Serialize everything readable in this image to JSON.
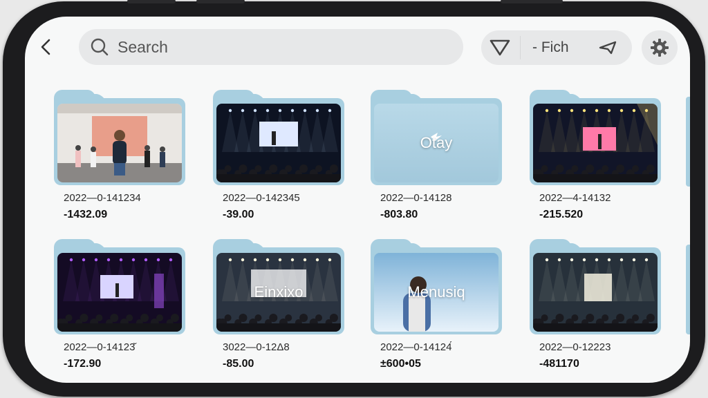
{
  "toolbar": {
    "search_placeholder": "Search",
    "filter_label": "- Fiсh"
  },
  "folders": [
    {
      "date": "2022—0-141234",
      "value": "-1432.09",
      "overlay": "",
      "scene": "stage-person",
      "accent": "#e7907a"
    },
    {
      "date": "2022—0-142345",
      "value": "-39.00",
      "overlay": "",
      "scene": "concert-white",
      "accent": "#dfe9ff"
    },
    {
      "date": "2022—0-14128",
      "value": "-803.80",
      "overlay": "Otay",
      "scene": "blank",
      "accent": "#b9d9e8"
    },
    {
      "date": "2022—4-14132",
      "value": "-215.520",
      "overlay": "",
      "scene": "concert-pink",
      "accent": "#ff7aa8"
    },
    {
      "date": "2022—0-14123̆",
      "value": "-172.90",
      "overlay": "",
      "scene": "concert-purple",
      "accent": "#b15cff"
    },
    {
      "date": "3022—0-12Δ8",
      "value": "-85.00",
      "overlay": "Einxixo",
      "scene": "concert-bright",
      "accent": "#ffffff"
    },
    {
      "date": "2022—0-14124́",
      "value": "±600•05",
      "overlay": "Menusiq",
      "scene": "person-sky",
      "accent": "#7fb3d8"
    },
    {
      "date": "2022—0-12223",
      "value": "-481170",
      "overlay": "",
      "scene": "concert-bright2",
      "accent": "#f4f1e0"
    }
  ],
  "colors": {
    "folder": "#a8cfe0",
    "screen_bg": "#f7f8f8",
    "control_bg": "#e7e8e9",
    "frame": "#1c1c1e"
  },
  "icons": {
    "back": "chevron-left-icon",
    "search": "search-icon",
    "filter": "filter-icon",
    "send": "send-icon",
    "settings": "gear-icon"
  }
}
